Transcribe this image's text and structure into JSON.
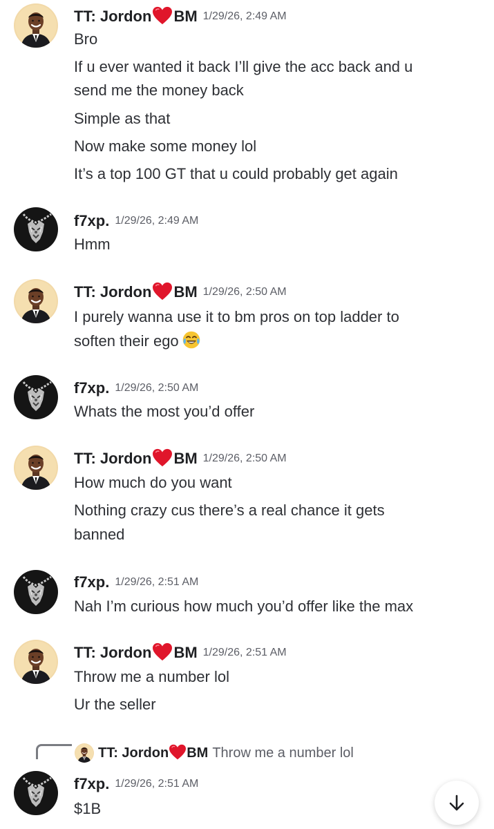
{
  "messages": [
    {
      "author": "TT: Jordon",
      "author_suffix": "BM",
      "timestamp": "1/29/26, 2:49 AM",
      "lines": [
        "Bro",
        "If u ever wanted it back I’ll give the acc back and u",
        "send me the money back",
        "Simple as that",
        "Now make some money lol",
        "It’s a top 100 GT that u could probably get again"
      ]
    },
    {
      "author": "f7xp.",
      "timestamp": "1/29/26, 2:49 AM",
      "lines": [
        "Hmm"
      ]
    },
    {
      "author": "TT: Jordon",
      "author_suffix": "BM",
      "timestamp": "1/29/26, 2:50 AM",
      "lines": [
        "I purely wanna use it to bm pros on top ladder to",
        "soften their ego"
      ]
    },
    {
      "author": "f7xp.",
      "timestamp": "1/29/26, 2:50 AM",
      "lines": [
        "Whats the most you’d offer"
      ]
    },
    {
      "author": "TT: Jordon",
      "author_suffix": "BM",
      "timestamp": "1/29/26, 2:50 AM",
      "lines": [
        "How much do you want",
        "Nothing crazy cus there’s a real chance it gets",
        "banned"
      ]
    },
    {
      "author": "f7xp.",
      "timestamp": "1/29/26, 2:51 AM",
      "lines": [
        "Nah I’m curious how much you’d offer like the max"
      ]
    },
    {
      "author": "TT: Jordon",
      "author_suffix": "BM",
      "timestamp": "1/29/26, 2:51 AM",
      "lines": [
        "Throw me a number lol",
        "Ur the seller"
      ]
    },
    {
      "author": "f7xp.",
      "timestamp": "1/29/26, 2:51 AM",
      "lines": [
        "$1B"
      ],
      "reply_to": {
        "author": "TT: Jordon",
        "author_suffix": "BM",
        "text": "Throw me a number lol"
      }
    }
  ],
  "icons": {
    "heart": "red-heart-emoji",
    "laugh": "tears-of-joy-emoji",
    "jump": "arrow-down-icon"
  },
  "colors": {
    "heart": "#e0162b",
    "text": "#2e3035",
    "timestamp": "#5c5e66"
  }
}
